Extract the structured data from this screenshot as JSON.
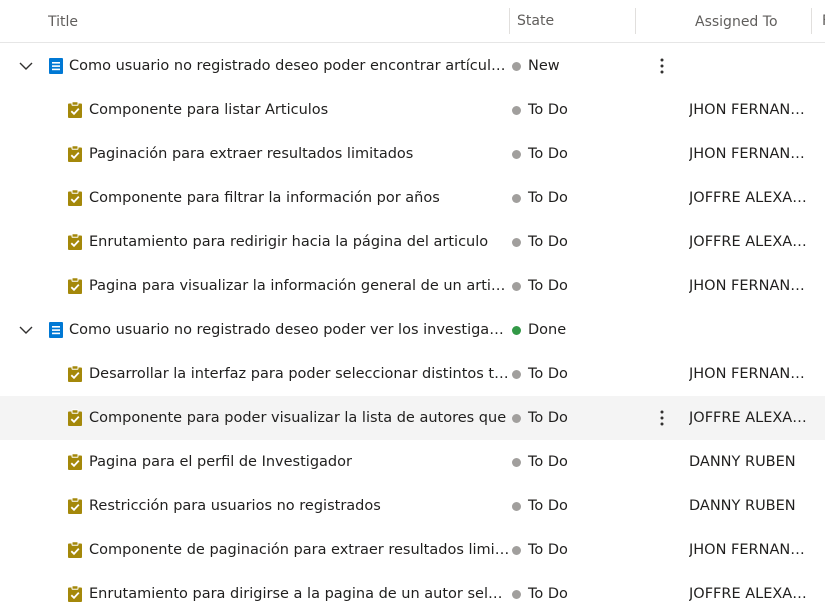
{
  "columns": {
    "title": "Title",
    "state": "State",
    "assigned": "Assigned To",
    "extra": "F"
  },
  "colors": {
    "new": "#a19f9d",
    "todo": "#a19f9d",
    "done": "#339947",
    "story_icon": "#0078d4",
    "task_icon": "#a4880a",
    "row_hover": "#f4f4f4"
  },
  "rows": [
    {
      "type": "story",
      "title": "Como usuario no registrado deseo poder encontrar artículos de investigación",
      "state": "New",
      "state_color": "#a19f9d",
      "assigned": ""
    },
    {
      "type": "task",
      "title": "Componente para listar Articulos",
      "state": "To Do",
      "state_color": "#a19f9d",
      "assigned": "JHON FERNANDO"
    },
    {
      "type": "task",
      "title": "Paginación para extraer resultados limitados",
      "state": "To Do",
      "state_color": "#a19f9d",
      "assigned": "JHON FERNANDO"
    },
    {
      "type": "task",
      "title": "Componente para filtrar la información por años",
      "state": "To Do",
      "state_color": "#a19f9d",
      "assigned": "JOFFRE ALEXANDER"
    },
    {
      "type": "task",
      "title": "Enrutamiento para redirigir hacia la página del articulo",
      "state": "To Do",
      "state_color": "#a19f9d",
      "assigned": "JOFFRE ALEXANDER"
    },
    {
      "type": "task",
      "title": "Pagina para visualizar la información general de un articulo",
      "state": "To Do",
      "state_color": "#a19f9d",
      "assigned": "JHON FERNANDO"
    },
    {
      "type": "story",
      "title": "Como usuario no registrado deseo poder ver los investigadores",
      "state": "Done",
      "state_color": "#339947",
      "assigned": ""
    },
    {
      "type": "task",
      "title": "Desarrollar la interfaz para poder seleccionar distintos tipos",
      "state": "To Do",
      "state_color": "#a19f9d",
      "assigned": "JHON FERNANDO"
    },
    {
      "type": "task",
      "title": "Componente para poder visualizar la lista de autores que",
      "state": "To Do",
      "state_color": "#a19f9d",
      "assigned": "JOFFRE ALEXANDER"
    },
    {
      "type": "task",
      "title": "Pagina para el perfil de Investigador",
      "state": "To Do",
      "state_color": "#a19f9d",
      "assigned": "DANNY RUBEN"
    },
    {
      "type": "task",
      "title": "Restricción para usuarios no registrados",
      "state": "To Do",
      "state_color": "#a19f9d",
      "assigned": "DANNY RUBEN"
    },
    {
      "type": "task",
      "title": "Componente de paginación para extraer resultados limitados",
      "state": "To Do",
      "state_color": "#a19f9d",
      "assigned": "JHON FERNANDO"
    },
    {
      "type": "task",
      "title": "Enrutamiento para dirigirse a la pagina de un autor seleccionado",
      "state": "To Do",
      "state_color": "#a19f9d",
      "assigned": "JOFFRE ALEXANDER"
    }
  ]
}
